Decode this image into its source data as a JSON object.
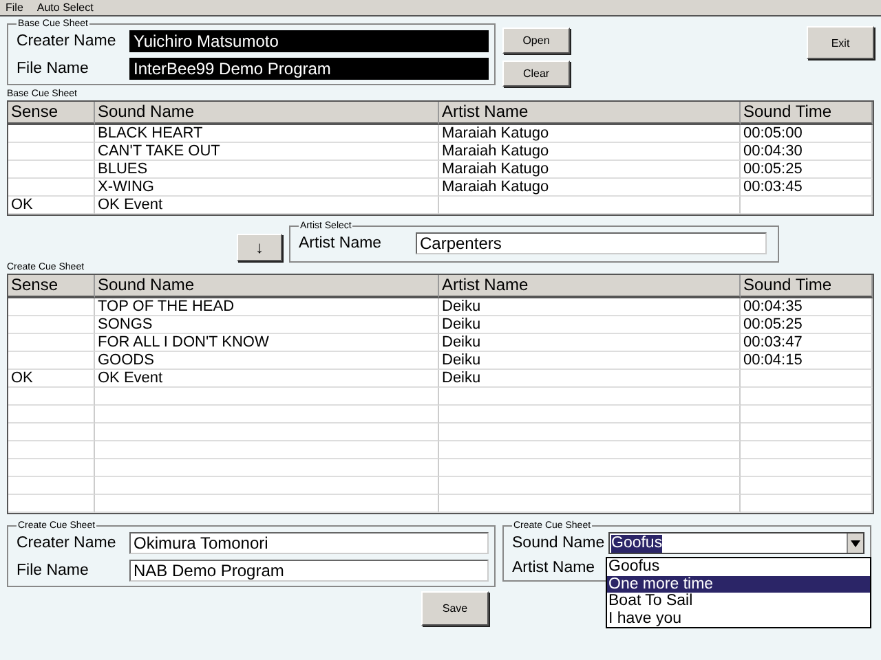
{
  "menu": [
    "File",
    "Auto Select"
  ],
  "base_group": {
    "title": "Base Cue Sheet",
    "fields": [
      {
        "label": "Creater Name",
        "value": "Yuichiro Matsumoto",
        "highlighted": true
      },
      {
        "label": "File Name",
        "value": "InterBee99 Demo Program",
        "highlighted": true
      }
    ]
  },
  "side_buttons": [
    "Open",
    "Clear"
  ],
  "exit_button": "Exit",
  "base_table": {
    "caption": "Base Cue Sheet",
    "columns": [
      "Sense",
      "Sound Name",
      "Artist Name",
      "Sound Time"
    ],
    "rows": [
      {
        "sound_name": "BLACK HEART",
        "artist_name": "Maraiah Katugo",
        "sound_time": "00:05:00"
      },
      {
        "sound_name": "CAN'T TAKE OUT",
        "artist_name": "Maraiah Katugo",
        "sound_time": "00:04:30"
      },
      {
        "sound_name": "BLUES",
        "artist_name": "Maraiah Katugo",
        "sound_time": "00:05:25"
      },
      {
        "sound_name": "X-WING",
        "artist_name": "Maraiah Katugo",
        "sound_time": "00:03:45"
      },
      {
        "sense": "OK",
        "sound_name": "OK Event"
      }
    ]
  },
  "copy_button": "↓",
  "artist_select": {
    "title": "Artist Select",
    "label": "Artist Name",
    "value": "Carpenters"
  },
  "create_table": {
    "caption": "Create Cue Sheet",
    "columns": [
      "Sense",
      "Sound Name",
      "Artist Name",
      "Sound Time"
    ],
    "rows": [
      {
        "sound_name": "TOP OF THE HEAD",
        "artist_name": "Deiku",
        "sound_time": "00:04:35"
      },
      {
        "sound_name": "SONGS",
        "artist_name": "Deiku",
        "sound_time": "00:05:25"
      },
      {
        "sound_name": "FOR ALL I DON'T KNOW",
        "artist_name": "Deiku",
        "sound_time": "00:03:47"
      },
      {
        "sound_name": "GOODS",
        "artist_name": "Deiku",
        "sound_time": "00:04:15"
      },
      {
        "sense": "OK",
        "sound_name": "OK Event",
        "artist_name": "Deiku"
      }
    ]
  },
  "create_group": {
    "title": "Create Cue Sheet",
    "fields": [
      {
        "label": "Creater Name",
        "value": "Okimura Tomonori",
        "highlighted": false
      },
      {
        "label": "File Name",
        "value": "NAB Demo Program",
        "highlighted": false
      }
    ]
  },
  "sound_group": {
    "title": "Create Cue Sheet",
    "sound_label": "Sound Name",
    "sound_value": "Goofus",
    "artist_label": "Artist Name",
    "expanded": true,
    "options": [
      {
        "label": "Goofus",
        "selected": false
      },
      {
        "label": "One more time",
        "selected": true
      },
      {
        "label": "Boat To Sail",
        "selected": false
      },
      {
        "label": "I have you",
        "selected": false
      }
    ]
  },
  "save_button": "Save"
}
